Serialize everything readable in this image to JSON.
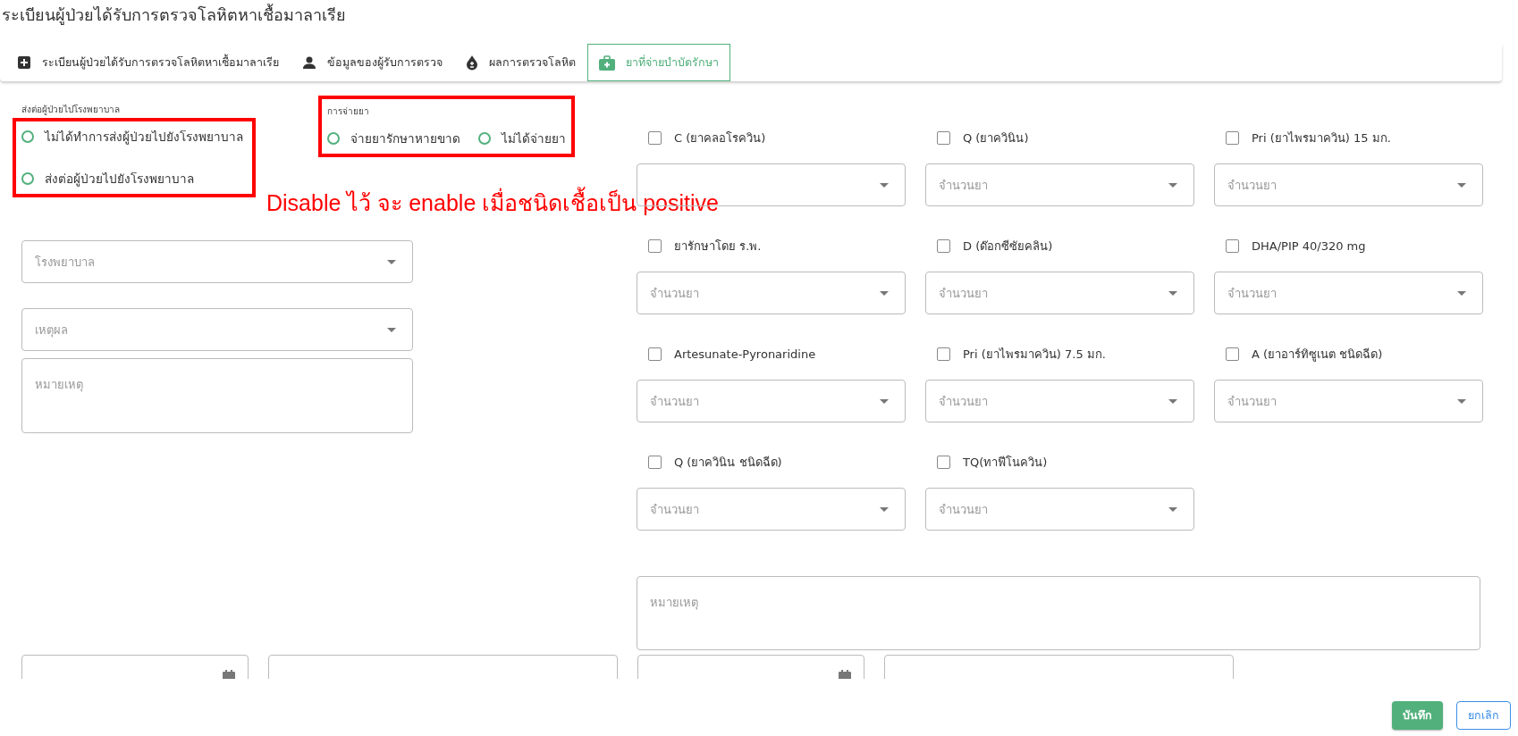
{
  "page_title": "ระเบียนผู้ป่วยได้รับการตรวจโลหิตหาเชื้อมาลาเรีย",
  "tabs": [
    {
      "label": "ระเบียนผู้ป่วยได้รับการตรวจโลหิตหาเชื้อมาลาเรีย",
      "selected": false
    },
    {
      "label": "ข้อมูลของผู้รับการตรวจ",
      "selected": false
    },
    {
      "label": "ผลการตรวจโลหิต",
      "selected": false
    },
    {
      "label": "ยาที่จ่ายบำบัดรักษา",
      "selected": true
    }
  ],
  "referral": {
    "label": "ส่งต่อผู้ป่วยไปโรงพยาบาล",
    "highlighted": true,
    "options": [
      {
        "label": "ไม่ได้ทำการส่งผู้ป่วยไปยังโรงพยาบาล",
        "selected": false
      },
      {
        "label": "ส่งต่อผู้ป่วยไปยังโรงพยาบาล",
        "selected": false
      }
    ]
  },
  "dispensing": {
    "label": "การจ่ายยา",
    "highlighted": true,
    "options": [
      {
        "label": "จ่ายยารักษาหายขาด",
        "selected": false
      },
      {
        "label": "ไม่ได้จ่ายยา",
        "selected": false
      }
    ]
  },
  "annotation": "Disable ไว้ จะ enable เมื่อชนิดเชื้อเป็น positive",
  "hospital_select": {
    "placeholder": "โรงพยาบาล"
  },
  "reason_select": {
    "placeholder": "เหตุผล"
  },
  "left_remarks": {
    "placeholder": "หมายเหตุ"
  },
  "drugs": [
    {
      "label": "C (ยาคลอโรควิน)",
      "checked": false
    },
    {
      "label": "Q (ยาควินิน)",
      "checked": false,
      "placeholder": "จำนวนยา"
    },
    {
      "label": "Pri (ยาไพรมาควิน) 15 มก.",
      "checked": false,
      "placeholder": "จำนวนยา"
    },
    {
      "label": "ยารักษาโดย ร.พ.",
      "checked": false,
      "placeholder": "จำนวนยา"
    },
    {
      "label": "D (ด๊อกซีซัยคลิน)",
      "checked": false,
      "placeholder": "จำนวนยา"
    },
    {
      "label": "DHA/PIP 40/320 mg",
      "checked": false,
      "placeholder": "จำนวนยา"
    },
    {
      "label": "Artesunate-Pyronaridine",
      "checked": false,
      "placeholder": "จำนวนยา"
    },
    {
      "label": "Pri (ยาไพรมาควิน) 7.5 มก.",
      "checked": false,
      "placeholder": "จำนวนยา"
    },
    {
      "label": "A (ยาอาร์ทิซูเนต ชนิดฉีด)",
      "checked": false,
      "placeholder": "จำนวนยา"
    },
    {
      "label": "Q (ยาควินิน ชนิดฉีด)",
      "checked": false,
      "placeholder": "จำนวนยา"
    },
    {
      "label": "TQ(ทาฟีโนควิน)",
      "checked": false,
      "placeholder": "จำนวนยา"
    }
  ],
  "right_remarks": {
    "placeholder": "หมายเหตุ"
  },
  "bottom_fields": [
    {
      "kind": "date"
    },
    {
      "kind": "text"
    },
    {
      "kind": "date"
    },
    {
      "kind": "text"
    }
  ],
  "buttons": [
    {
      "label": "บันทึก",
      "kind": "primary"
    },
    {
      "label": "ยกเลิก",
      "kind": "outline"
    }
  ]
}
